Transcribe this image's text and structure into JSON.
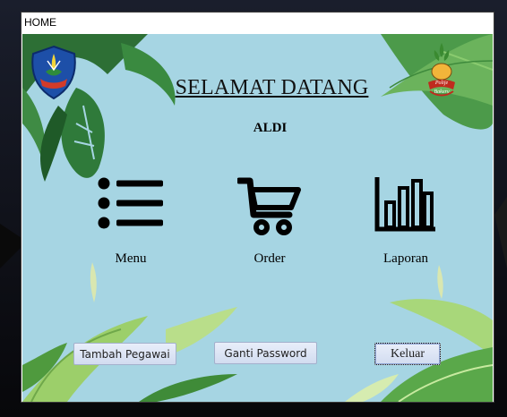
{
  "window": {
    "title": "HOME"
  },
  "header": {
    "welcome": "SELAMAT DATANG",
    "username": "ALDI"
  },
  "logos": {
    "right_text": "Polije Bakery"
  },
  "menu": [
    {
      "label": "Menu",
      "icon": "list-icon"
    },
    {
      "label": "Order",
      "icon": "cart-icon"
    },
    {
      "label": "Laporan",
      "icon": "bar-chart-icon"
    }
  ],
  "buttons": {
    "add_employee": "Tambah Pegawai",
    "change_password": "Ganti Password",
    "logout": "Keluar"
  },
  "colors": {
    "background": "#a6d5e3",
    "leaf": "#2f7a3a",
    "button": "#dce4f4"
  }
}
